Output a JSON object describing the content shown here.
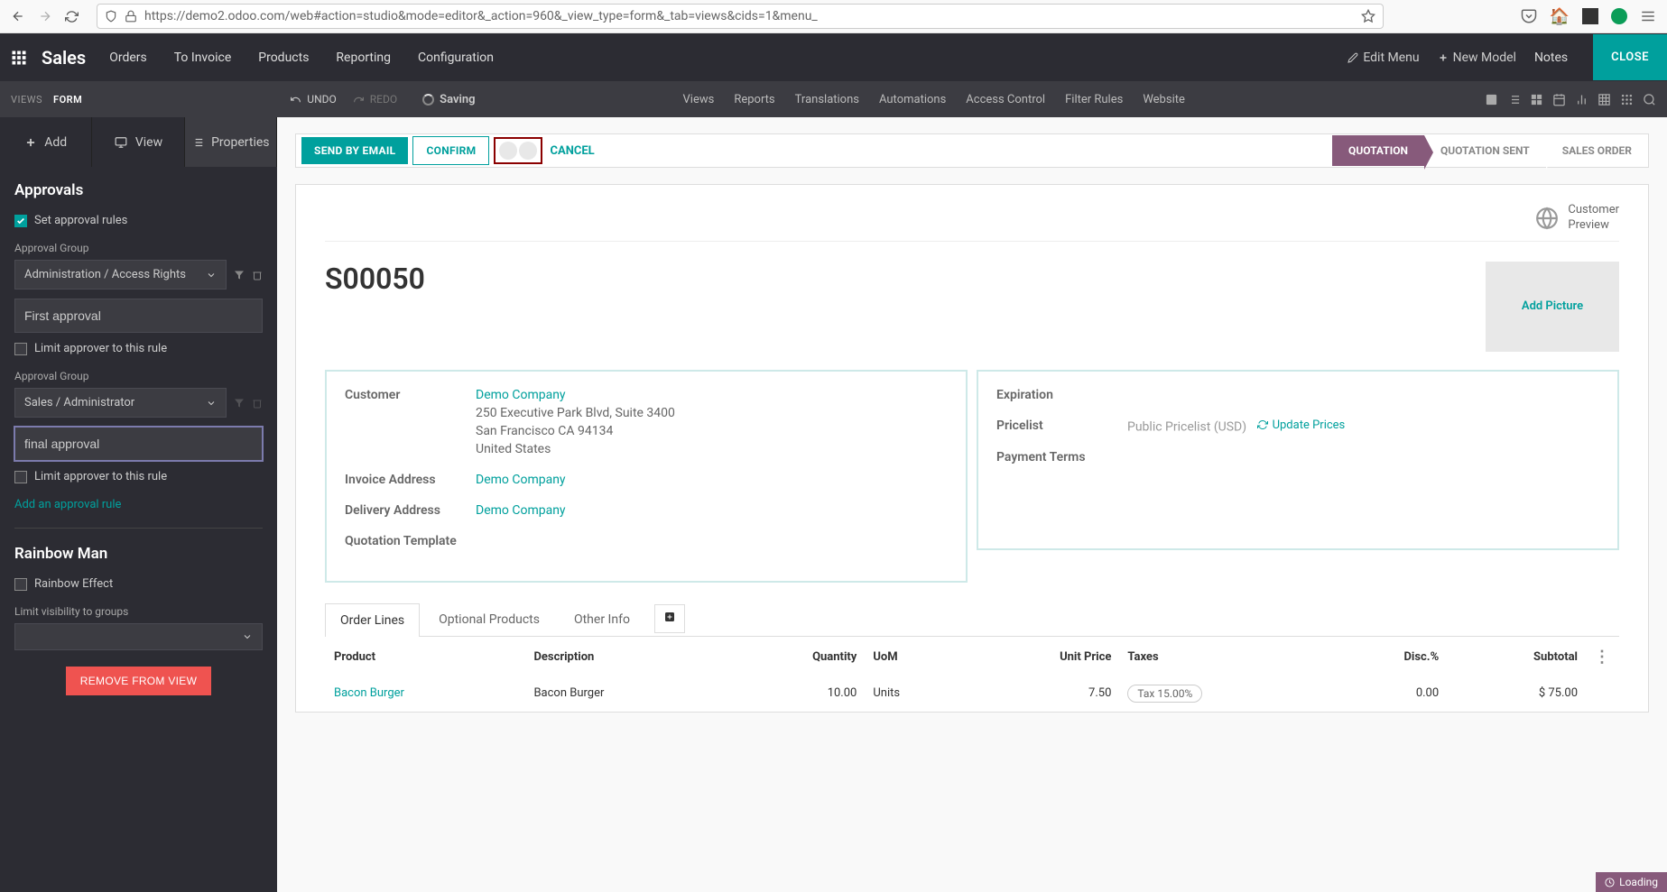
{
  "browser": {
    "url": "https://demo2.odoo.com/web#action=studio&mode=editor&_action=960&_view_type=form&_tab=views&cids=1&menu_"
  },
  "topbar": {
    "app": "Sales",
    "nav": [
      "Orders",
      "To Invoice",
      "Products",
      "Reporting",
      "Configuration"
    ],
    "edit_menu": "Edit Menu",
    "new_model": "New Model",
    "notes": "Notes",
    "close": "CLOSE"
  },
  "secondbar": {
    "views": "VIEWS",
    "form": "FORM",
    "undo": "UNDO",
    "redo": "REDO",
    "saving": "Saving",
    "menu": [
      "Views",
      "Reports",
      "Translations",
      "Automations",
      "Access Control",
      "Filter Rules",
      "Website"
    ]
  },
  "sidebar": {
    "tabs": {
      "add": "Add",
      "view": "View",
      "properties": "Properties"
    },
    "approvals": {
      "title": "Approvals",
      "set_rules": "Set approval rules",
      "group_label": "Approval Group",
      "rule1_group": "Administration / Access Rights",
      "rule1_text": "First approval",
      "rule2_group": "Sales / Administrator",
      "rule2_text": "final approval",
      "limit": "Limit approver to this rule",
      "add_rule": "Add an approval rule"
    },
    "rainbow": {
      "title": "Rainbow Man",
      "effect": "Rainbow Effect",
      "limit_groups": "Limit visibility to groups"
    },
    "remove": "REMOVE FROM VIEW"
  },
  "statusbar": {
    "send": "SEND BY EMAIL",
    "confirm": "CONFIRM",
    "cancel": "CANCEL",
    "stages": [
      "QUOTATION",
      "QUOTATION SENT",
      "SALES ORDER"
    ]
  },
  "form": {
    "customer_preview": "Customer",
    "customer_preview2": "Preview",
    "title": "S00050",
    "add_picture": "Add Picture",
    "labels": {
      "customer": "Customer",
      "invoice": "Invoice Address",
      "delivery": "Delivery Address",
      "template": "Quotation Template",
      "expiration": "Expiration",
      "pricelist": "Pricelist",
      "payment": "Payment Terms"
    },
    "customer": {
      "name": "Demo Company",
      "addr1": "250 Executive Park Blvd, Suite 3400",
      "addr2": "San Francisco CA 94134",
      "addr3": "United States"
    },
    "invoice_addr": "Demo Company",
    "delivery_addr": "Demo Company",
    "pricelist": "Public Pricelist (USD)",
    "update_prices": "Update Prices"
  },
  "tabs": [
    "Order Lines",
    "Optional Products",
    "Other Info"
  ],
  "table": {
    "headers": {
      "product": "Product",
      "description": "Description",
      "quantity": "Quantity",
      "uom": "UoM",
      "unitprice": "Unit Price",
      "taxes": "Taxes",
      "disc": "Disc.%",
      "subtotal": "Subtotal"
    },
    "row": {
      "product": "Bacon Burger",
      "description": "Bacon Burger",
      "quantity": "10.00",
      "uom": "Units",
      "unitprice": "7.50",
      "tax": "Tax 15.00%",
      "disc": "0.00",
      "subtotal": "$ 75.00"
    }
  },
  "loading": "Loading"
}
